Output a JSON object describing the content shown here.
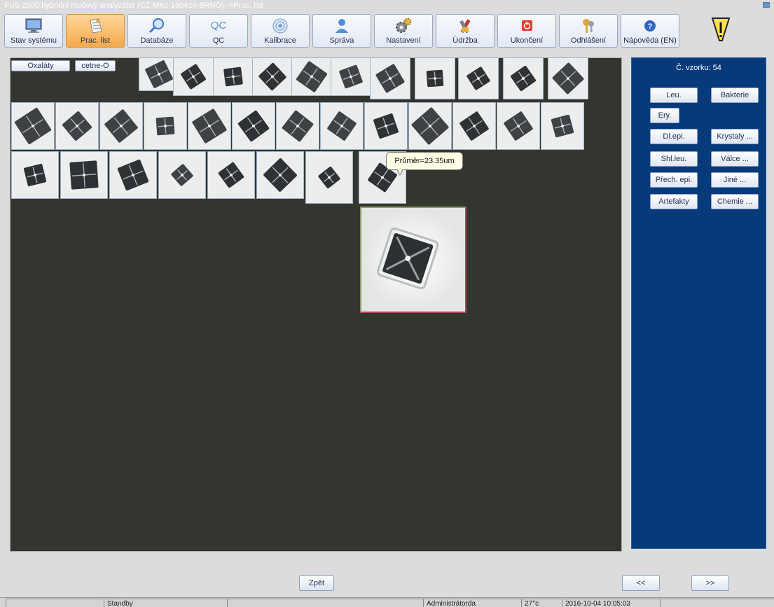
{
  "window": {
    "title": "FUS-2000 hybridní močový analyzátor (CZ-MKc-160414-BRNO)-->Prac. list"
  },
  "toolbar": {
    "buttons": [
      {
        "label": "Stav systému",
        "icon": "monitor-icon"
      },
      {
        "label": "Prac. list",
        "icon": "worksheet-icon",
        "active": true
      },
      {
        "label": "Databáze",
        "icon": "magnifier-icon"
      },
      {
        "label": "QC",
        "icon": "qc-icon"
      },
      {
        "label": "Kalibrace",
        "icon": "target-icon"
      },
      {
        "label": "Správa",
        "icon": "user-icon"
      },
      {
        "label": "Nastavení",
        "icon": "gears-icon"
      },
      {
        "label": "Údržba",
        "icon": "tools-icon"
      },
      {
        "label": "Ukončení",
        "icon": "power-icon"
      },
      {
        "label": "Odhlášení",
        "icon": "keys-icon"
      },
      {
        "label": "Nápověda (EN)",
        "icon": "help-icon"
      }
    ],
    "qc_icon_text": "QC"
  },
  "tabs": {
    "category": "Oxaláty",
    "subcategory": "cetne-O"
  },
  "tooltip": {
    "text": "Průměr=23.35um"
  },
  "right_panel": {
    "sample_label": "Č. vzorku: 54",
    "buttons": {
      "leu": "Leu.",
      "bakterie": "Bakterie",
      "ery": "Ery.",
      "dl_epi": "Dl.epi.",
      "krystaly": "Krystaly ...",
      "shl_leu": "Shl.leu.",
      "valce": "Válce ...",
      "prech_epi": "Přech. epi.",
      "jine": "Jiné ...",
      "artefakty": "Artefakty",
      "chemie": "Chemie ..."
    }
  },
  "nav": {
    "back": "Zpět",
    "prev": "<<",
    "next": ">>"
  },
  "statusbar": {
    "state": "Standby",
    "user": "Administrátorda",
    "center": "27°c",
    "datetime": "2016-10-04 10:05:03"
  },
  "colors": {
    "workarea_bg": "#33352f",
    "panel_bg": "#063a7a",
    "active_button": "#f6a94c"
  }
}
